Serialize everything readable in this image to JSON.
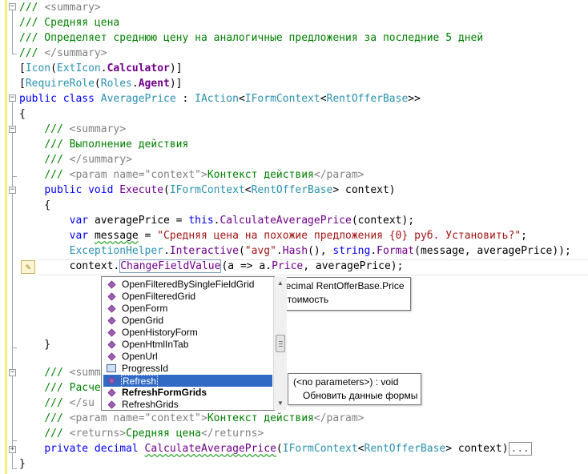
{
  "editor": {
    "lines": [
      [
        [
          "c",
          "/// "
        ],
        [
          "x",
          "<summary>"
        ]
      ],
      [
        [
          "c",
          "/// Средняя цена"
        ]
      ],
      [
        [
          "c",
          "/// Определяет среднюю цену на аналогичные предложения за последние 5 дней"
        ]
      ],
      [
        [
          "c",
          "/// "
        ],
        [
          "x",
          "</summary>"
        ]
      ],
      [
        [
          "p",
          "["
        ],
        [
          "t",
          "Icon"
        ],
        [
          "p",
          "("
        ],
        [
          "t",
          "ExtIcon"
        ],
        [
          "p",
          "."
        ],
        [
          "b",
          "Calculator"
        ],
        [
          "p",
          ")]"
        ]
      ],
      [
        [
          "p",
          "["
        ],
        [
          "t",
          "RequireRole"
        ],
        [
          "p",
          "("
        ],
        [
          "t",
          "Roles"
        ],
        [
          "p",
          "."
        ],
        [
          "b",
          "Agent"
        ],
        [
          "p",
          ")]"
        ]
      ],
      [
        [
          "k",
          "public class "
        ],
        [
          "t",
          "AveragePrice"
        ],
        [
          "p",
          " : "
        ],
        [
          "t",
          "IAction"
        ],
        [
          "p",
          "<"
        ],
        [
          "t",
          "IFormContext"
        ],
        [
          "p",
          "<"
        ],
        [
          "t",
          "RentOfferBase"
        ],
        [
          "p",
          ">>"
        ]
      ],
      [
        [
          "p",
          "{"
        ]
      ],
      [
        [
          "p",
          "    "
        ],
        [
          "c",
          "/// "
        ],
        [
          "x",
          "<summary>"
        ]
      ],
      [
        [
          "p",
          "    "
        ],
        [
          "c",
          "/// Выполнение действия"
        ]
      ],
      [
        [
          "p",
          "    "
        ],
        [
          "c",
          "/// "
        ],
        [
          "x",
          "</summary>"
        ]
      ],
      [
        [
          "p",
          "    "
        ],
        [
          "c",
          "/// "
        ],
        [
          "x",
          "<param name=\"context\">"
        ],
        [
          "c",
          "Контекст действия"
        ],
        [
          "x",
          "</param>"
        ]
      ],
      [
        [
          "p",
          "    "
        ],
        [
          "k",
          "public void "
        ],
        [
          "m",
          "Execute"
        ],
        [
          "p",
          "("
        ],
        [
          "t",
          "IFormContext"
        ],
        [
          "p",
          "<"
        ],
        [
          "t",
          "RentOfferBase"
        ],
        [
          "p",
          "> context)"
        ]
      ],
      [
        [
          "p",
          "    {"
        ]
      ],
      [
        [
          "p",
          "        "
        ],
        [
          "k",
          "var "
        ],
        [
          "p",
          "averagePrice = "
        ],
        [
          "k",
          "this"
        ],
        [
          "p",
          "."
        ],
        [
          "m",
          "CalculateAveragePrice"
        ],
        [
          "p",
          "(context);"
        ]
      ],
      [
        [
          "p",
          "        "
        ],
        [
          "k",
          "var "
        ],
        [
          "sq",
          "message"
        ],
        [
          "p",
          " = "
        ],
        [
          "s",
          "\"Средняя цена на похожие предложения {0} руб. Установить?\""
        ],
        [
          "p",
          ";"
        ]
      ],
      [
        [
          "p",
          "        "
        ],
        [
          "t",
          "ExceptionHelper"
        ],
        [
          "p",
          "."
        ],
        [
          "m",
          "Interactive"
        ],
        [
          "p",
          "("
        ],
        [
          "s",
          "\"avg\""
        ],
        [
          "p",
          "."
        ],
        [
          "m",
          "Hash"
        ],
        [
          "p",
          "(), "
        ],
        [
          "k",
          "string"
        ],
        [
          "p",
          "."
        ],
        [
          "m",
          "Format"
        ],
        [
          "p",
          "(message, averagePrice));"
        ]
      ],
      [
        [
          "p",
          "        context."
        ],
        [
          "hm",
          "ChangeFieldValue"
        ],
        [
          "p",
          "(a => a."
        ],
        [
          "f",
          "Price"
        ],
        [
          "p",
          ", averagePrice);"
        ]
      ],
      [],
      [],
      [],
      [],
      [],
      [
        [
          "p",
          "    }"
        ]
      ],
      [],
      [
        [
          "p",
          "    "
        ],
        [
          "c",
          "/// "
        ],
        [
          "x",
          "<summ"
        ]
      ],
      [
        [
          "p",
          "    "
        ],
        [
          "c",
          "/// Расче"
        ]
      ],
      [
        [
          "p",
          "    "
        ],
        [
          "c",
          "/// "
        ],
        [
          "x",
          "</su"
        ]
      ],
      [
        [
          "p",
          "    "
        ],
        [
          "c",
          "/// "
        ],
        [
          "x",
          "<param name=\"context\">"
        ],
        [
          "c",
          "Контекст действия"
        ],
        [
          "x",
          "</param>"
        ]
      ],
      [
        [
          "p",
          "    "
        ],
        [
          "c",
          "/// "
        ],
        [
          "x",
          "<returns>"
        ],
        [
          "c",
          "Средняя цена"
        ],
        [
          "x",
          "</returns>"
        ]
      ],
      [
        [
          "p",
          "    "
        ],
        [
          "k",
          "private decimal "
        ],
        [
          "sm",
          "CalculateAveragePrice"
        ],
        [
          "p",
          "("
        ],
        [
          "t",
          "IFormContext"
        ],
        [
          "p",
          "<"
        ],
        [
          "t",
          "RentOfferBase"
        ],
        [
          "p",
          "> context)"
        ],
        [
          "box",
          "..."
        ]
      ],
      [
        [
          "p",
          "}"
        ]
      ]
    ]
  },
  "completion": {
    "items": [
      {
        "label": "OpenFilteredBySingleFieldGrid",
        "kind": "method"
      },
      {
        "label": "OpenFilteredGrid",
        "kind": "method"
      },
      {
        "label": "OpenForm",
        "kind": "method"
      },
      {
        "label": "OpenGrid",
        "kind": "method"
      },
      {
        "label": "OpenHistoryForm",
        "kind": "method"
      },
      {
        "label": "OpenHtmlInTab",
        "kind": "method"
      },
      {
        "label": "OpenUrl",
        "kind": "method"
      },
      {
        "label": "ProgressId",
        "kind": "property"
      },
      {
        "label": "Refresh",
        "kind": "method",
        "selected": true
      },
      {
        "label": "RefreshFormGrids",
        "kind": "method",
        "bold": true
      },
      {
        "label": "RefreshGrids",
        "kind": "method"
      }
    ]
  },
  "tooltips": {
    "signature": {
      "line1": "decimal RentOfferBase.Price",
      "line2": "Стоимость"
    },
    "member": {
      "line1": "(<no parameters>) : void",
      "line2": "Обновить данные формы"
    }
  },
  "colors": {
    "comment": "#008000",
    "xmldoc": "#808080",
    "keyword": "#0000ff",
    "type": "#2b91af",
    "method": "#6f008a",
    "string": "#a31515",
    "selection": "#316ac5",
    "change_margin": "#f4f178"
  }
}
